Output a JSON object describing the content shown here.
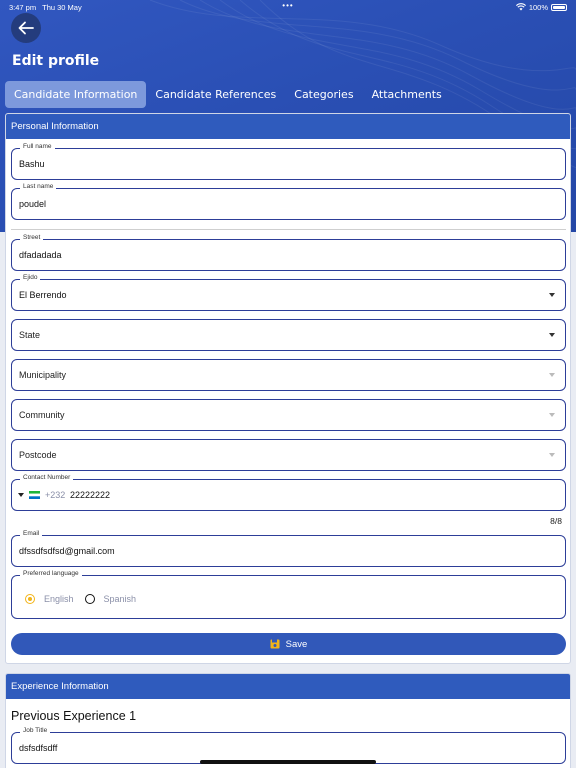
{
  "status_bar": {
    "time": "3:47 pm",
    "date": "Thu 30 May",
    "dots": "•••",
    "battery": "100%"
  },
  "header": {
    "title": "Edit profile"
  },
  "tabs": [
    {
      "label": "Candidate Information",
      "active": true
    },
    {
      "label": "Candidate References"
    },
    {
      "label": "Categories"
    },
    {
      "label": "Attachments"
    }
  ],
  "personal": {
    "heading": "Personal Information",
    "full_name": {
      "label": "Full name",
      "value": "Bashu"
    },
    "last_name": {
      "label": "Last name",
      "value": "poudel"
    },
    "street": {
      "label": "Street",
      "value": "dfadadada"
    },
    "ejido": {
      "label": "Ejido",
      "value": "El Berrendo"
    },
    "state": {
      "placeholder": "State"
    },
    "municipality": {
      "placeholder": "Municipality"
    },
    "community": {
      "placeholder": "Community"
    },
    "postcode": {
      "placeholder": "Postcode"
    },
    "contact": {
      "label": "Contact Number",
      "dial_code": "+232",
      "value": "22222222",
      "counter": "8/8"
    },
    "email": {
      "label": "Email",
      "value": "dfssdfsdfsd@gmail.com"
    },
    "language": {
      "label": "Preferred language",
      "options": [
        "English",
        "Spanish"
      ],
      "selected": "English"
    },
    "save_label": "Save"
  },
  "experience": {
    "heading": "Experience Information",
    "subheading": "Previous Experience 1",
    "job_title": {
      "label": "Job Title",
      "value": "dsfsdfsdff"
    }
  },
  "colors": {
    "primary": "#2f5bbd",
    "field_border": "#2d3e98",
    "radio_selected": "#f2b418"
  }
}
